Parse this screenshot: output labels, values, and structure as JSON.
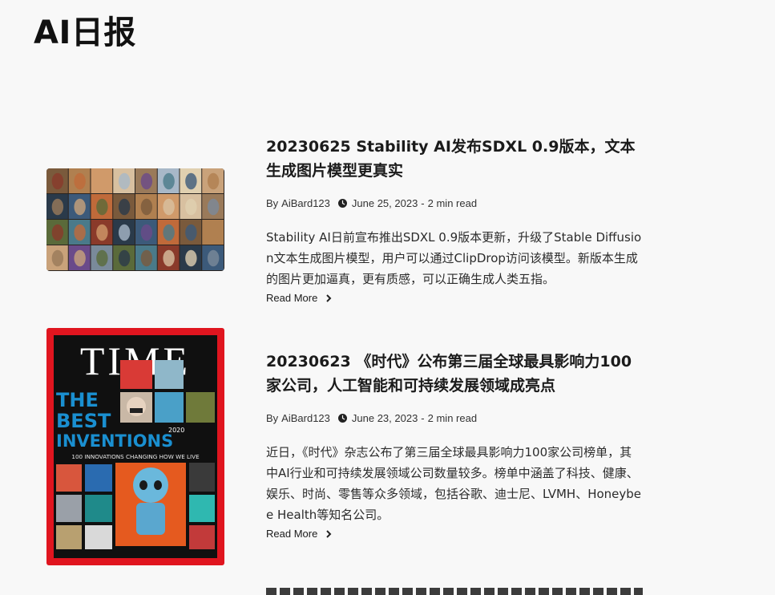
{
  "site": {
    "title": "AI日报"
  },
  "posts": [
    {
      "title": "20230625 Stability AI发布SDXL 0.9版本，文本生成图片模型更真实",
      "author": "AiBard123",
      "date": "June 25, 2023",
      "read_time": "2 min read",
      "excerpt": "Stability AI日前宣布推出SDXL 0.9版本更新，升级了Stable Diffusion文本生成图片模型，用户可以通过ClipDrop访问该模型。新版本生成的图片更加逼真，更有质感，可以正确生成人类五指。",
      "read_more": "Read More"
    },
    {
      "title": "20230623 《时代》公布第三届全球最具影响力100家公司，人工智能和可持续发展领域成亮点",
      "author": "AiBard123",
      "date": "June 23, 2023",
      "read_time": "2 min read",
      "excerpt": "近日，《时代》杂志公布了第三届全球最具影响力100家公司榜单，其中AI行业和可持续发展领域公司数量较多。榜单中涵盖了科技、健康、娱乐、时尚、零售等众多领域，包括谷歌、迪士尼、LVMH、Honeybee Health等知名公司。",
      "read_more": "Read More",
      "cover": {
        "masthead": "TIME",
        "headline_1": "THE",
        "headline_2": "BEST",
        "headline_3": "INVENTIONS",
        "year": "2020",
        "subline": "100 INNOVATIONS CHANGING HOW WE LIVE"
      }
    }
  ],
  "colors": {
    "time_red": "#e0151f",
    "accent_blue": "#1a8fd0"
  }
}
